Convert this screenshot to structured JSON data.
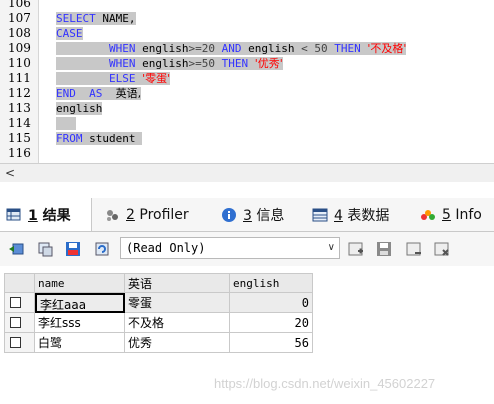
{
  "editor": {
    "lines": [
      {
        "n": "106"
      },
      {
        "n": "107",
        "select": "SELECT",
        "name": "NAME,"
      },
      {
        "n": "108",
        "case": "CASE"
      },
      {
        "n": "109",
        "when": "WHEN",
        "field": "english",
        "op1": ">=",
        "v1": "20",
        "and": "AND",
        "field2": "english",
        "op2": "<",
        "v2": "50",
        "then": "THEN",
        "result": "'不及格'"
      },
      {
        "n": "110",
        "when": "WHEN",
        "field": "english",
        "op1": ">=",
        "v1": "50",
        "then": "THEN",
        "result": "'优秀'"
      },
      {
        "n": "111",
        "else": "ELSE",
        "result": "'零蛋'"
      },
      {
        "n": "112",
        "end": "END",
        "as": "AS",
        "alias": "英语,"
      },
      {
        "n": "113",
        "field": "english"
      },
      {
        "n": "114"
      },
      {
        "n": "115",
        "from": "FROM",
        "table": "student"
      },
      {
        "n": "116"
      }
    ],
    "scroll_left_glyph": "<"
  },
  "tabs": [
    {
      "num": "1",
      "label": "结果",
      "icon": "result-grid-icon",
      "active": true
    },
    {
      "num": "2",
      "label": "Profiler",
      "icon": "profiler-icon"
    },
    {
      "num": "3",
      "label": "信息",
      "icon": "info-icon"
    },
    {
      "num": "4",
      "label": "表数据",
      "icon": "table-data-icon"
    },
    {
      "num": "5",
      "label": "Info",
      "icon": "info-circle-icon"
    }
  ],
  "toolbar": {
    "mode_select": {
      "value": "(Read Only)"
    },
    "icons_left": [
      "export-icon",
      "copy-icon",
      "save-grid-icon",
      "refresh-icon"
    ],
    "icons_right": [
      "add-row-icon",
      "save-icon",
      "delete-row-icon",
      "cancel-icon"
    ]
  },
  "result": {
    "columns": [
      "name",
      "英语",
      "english"
    ],
    "rows": [
      [
        "李红aaa",
        "零蛋",
        "0"
      ],
      [
        "李红sss",
        "不及格",
        "20"
      ],
      [
        "白鹭",
        "优秀",
        "56"
      ]
    ]
  },
  "watermark": "https://blog.csdn.net/weixin_45602227",
  "colors": {
    "keyword": "#3333ff",
    "string": "#ff0000",
    "selection": "#c8c8c8"
  }
}
